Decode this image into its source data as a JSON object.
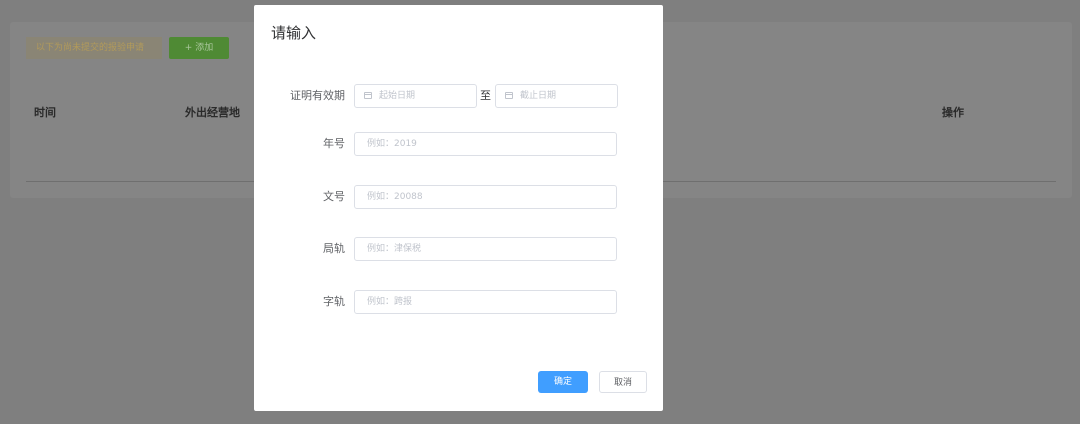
{
  "background": {
    "notice": "以下为尚未提交的报验申请",
    "add_button": "+ 添加",
    "columns": [
      "时间",
      "外出经营地",
      "操作"
    ]
  },
  "dialog": {
    "title": "请输入",
    "validity_label": "证明有效期",
    "start_placeholder": "起始日期",
    "range_separator": "至",
    "end_placeholder": "截止日期",
    "fields": [
      {
        "label": "年号",
        "placeholder": "例如：2019"
      },
      {
        "label": "文号",
        "placeholder": "例如：20088"
      },
      {
        "label": "局轨",
        "placeholder": "例如：津保税"
      },
      {
        "label": "字轨",
        "placeholder": "例如：跨报"
      }
    ],
    "confirm_label": "确定",
    "cancel_label": "取消"
  },
  "colors": {
    "primary": "#409eff",
    "overlay": "#808080",
    "success": "#4f8a34"
  }
}
